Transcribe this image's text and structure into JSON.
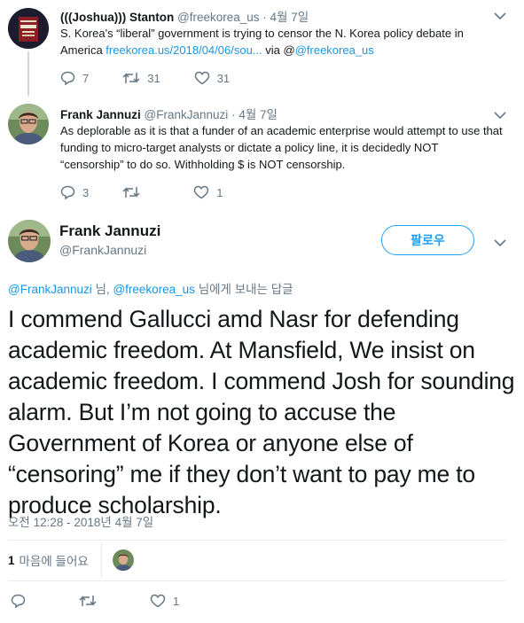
{
  "tweet1": {
    "name": "(((Joshua))) Stanton",
    "handle": "@freekorea_us",
    "date": "4월 7일",
    "text_before": "S. Korea's “liberal” government is trying to censor the N. Korea policy debate in America ",
    "link": "freekorea.us/2018/04/06/sou...",
    "via": " via @",
    "via_handle": "@freekorea_us",
    "reply_count": "7",
    "retweet_count": "31",
    "like_count": "31"
  },
  "tweet2": {
    "name": "Frank Jannuzi",
    "handle": "@FrankJannuzi",
    "date": "4월 7일",
    "text": "As deplorable as it is that a funder of an academic enterprise would attempt to use that funding to micro-target analysts or dictate a policy line, it is decidedly NOT “censorship” to do so. Withholding $ is NOT censorship.",
    "reply_count": "3",
    "retweet_count": "",
    "like_count": "1"
  },
  "main": {
    "name": "Frank Jannuzi",
    "handle": "@FrankJannuzi",
    "follow_label": "팔로우",
    "reply_to_handle1": "@FrankJannuzi",
    "reply_to_sep": " 님, ",
    "reply_to_handle2": "@freekorea_us",
    "reply_to_suffix": " 님에게 보내는 답글",
    "text": "I commend Gallucci amd Nasr for defending academic freedom. At Mansfield, We insist on academic freedom.  I commend Josh for sounding alarm. But I’m not going to accuse the Government of Korea or anyone else of “censoring” me if they don’t want to pay me to produce scholarship.",
    "timestamp": "오전 12:28 - 2018년 4월 7일",
    "likes_count": "1",
    "likes_label": "마음에 들어요",
    "like_action_count": "1"
  },
  "colors": {
    "link": "#1b95e0",
    "muted": "#657786",
    "follow": "#1da1f2"
  },
  "icons": [
    "reply-icon",
    "retweet-icon",
    "heart-icon",
    "chevron-down-icon"
  ]
}
